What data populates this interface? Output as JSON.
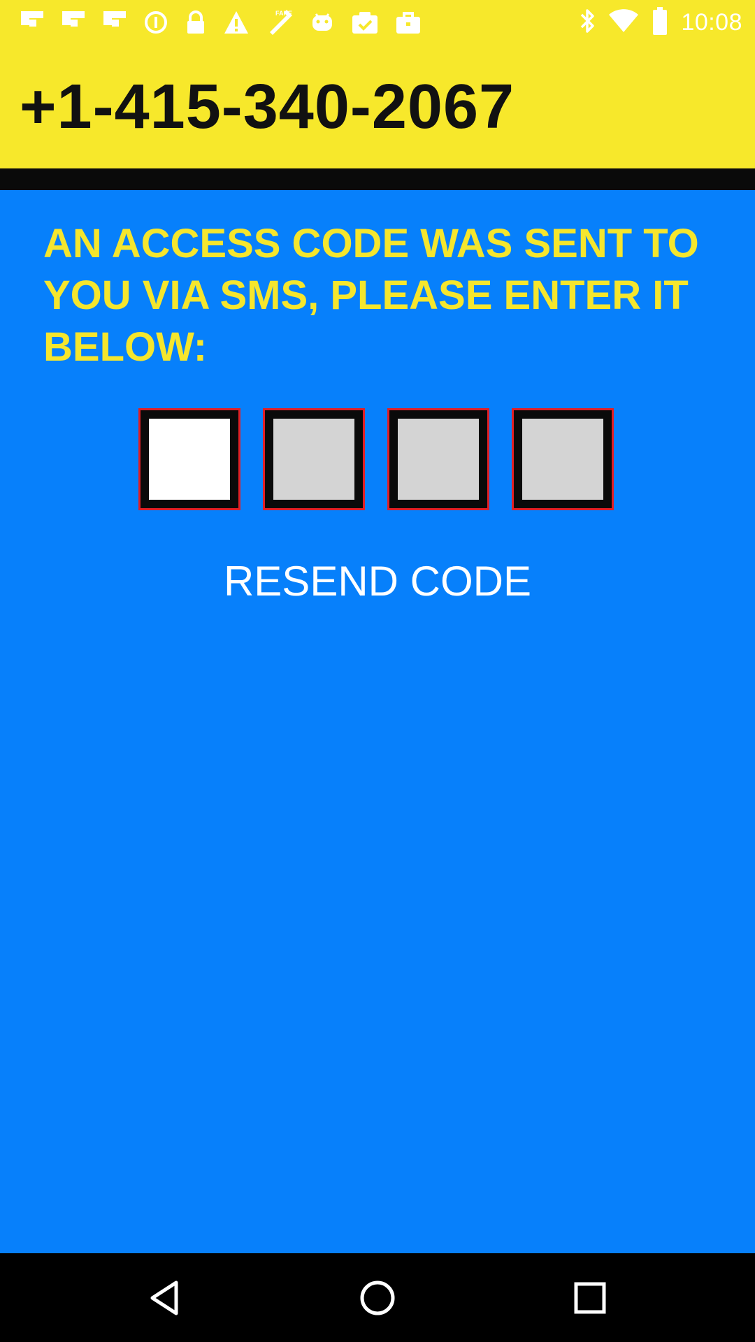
{
  "status_bar": {
    "time": "10:08",
    "left_icons": [
      "flipboard-icon",
      "flipboard-icon",
      "flipboard-icon",
      "data-saver-icon",
      "lock-icon",
      "warning-icon",
      "fake-gps-icon",
      "android-icon",
      "clipboard-check-icon",
      "briefcase-icon"
    ],
    "right_icons": [
      "bluetooth-icon",
      "wifi-icon",
      "battery-icon"
    ]
  },
  "header": {
    "phone_number": "+1-415-340-2067"
  },
  "main": {
    "message": "AN ACCESS CODE WAS SENT TO YOU VIA SMS, PLEASE ENTER IT BELOW:",
    "code_digits": [
      "",
      "",
      "",
      ""
    ],
    "resend_label": "RESEND CODE"
  },
  "nav": {
    "back": "back-icon",
    "home": "home-icon",
    "recents": "recents-icon"
  },
  "colors": {
    "background": "#0780fb",
    "header": "#f7e82b",
    "message_text": "#f5e62d",
    "box_border": "#e01f26"
  }
}
